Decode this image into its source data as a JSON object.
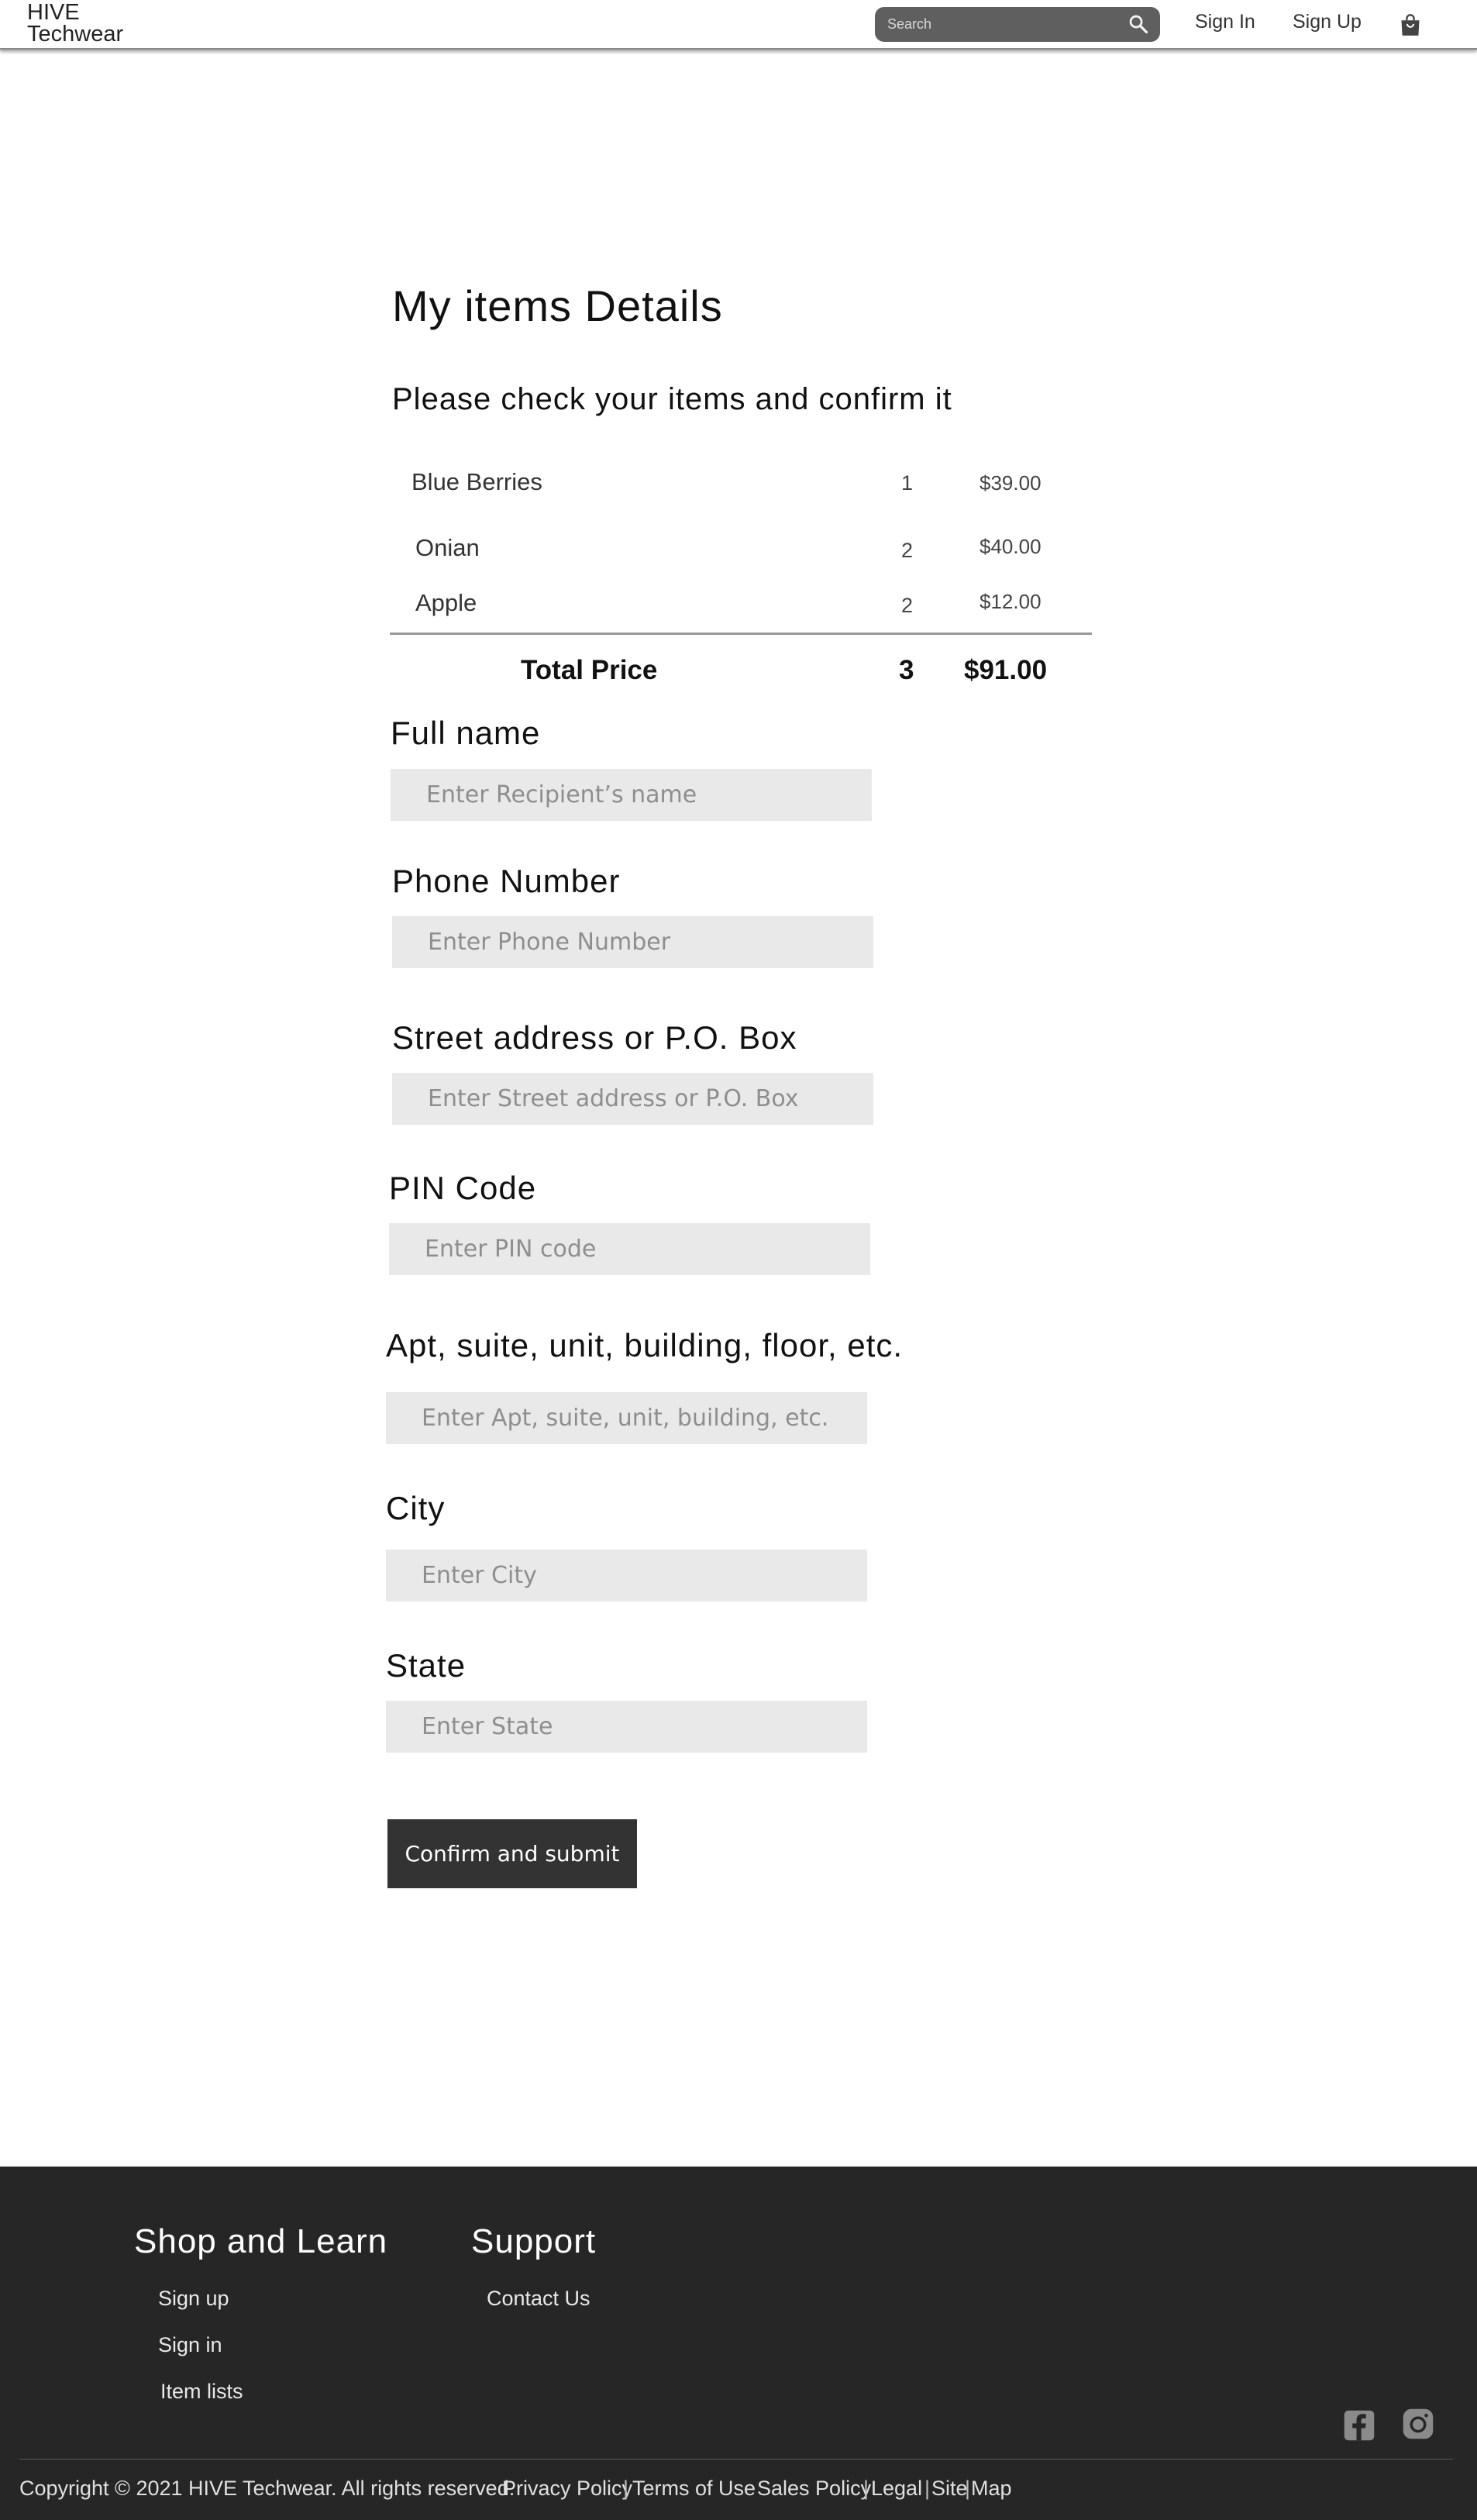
{
  "header": {
    "logo_line1": "HIVE",
    "logo_line2": "Techwear",
    "search_placeholder": "Search",
    "search_icon": "search-icon",
    "nav": {
      "sign_in": "Sign In",
      "sign_up": "Sign Up"
    },
    "cart_icon": "shopping-bag-icon"
  },
  "main": {
    "title": "My items Details",
    "subtitle": "Please check your items and confirm it",
    "items": [
      {
        "name": "Blue Berries",
        "qty": "1",
        "price": "$39.00"
      },
      {
        "name": "Onian",
        "qty": "2",
        "price": "$40.00"
      },
      {
        "name": "Apple",
        "qty": "2",
        "price": "$12.00"
      }
    ],
    "total": {
      "label": "Total Price",
      "qty": "3",
      "price": "$91.00"
    },
    "form": {
      "full_name": {
        "label": "Full name",
        "placeholder": "Enter Recipient’s name",
        "value": ""
      },
      "phone": {
        "label": "Phone Number",
        "placeholder": "Enter Phone Number",
        "value": ""
      },
      "street": {
        "label": "Street address or P.O. Box",
        "placeholder": "Enter Street address or P.O. Box",
        "value": ""
      },
      "pin": {
        "label": "PIN Code",
        "placeholder": "Enter PIN code",
        "value": ""
      },
      "apt": {
        "label": "Apt, suite, unit, building, floor, etc.",
        "placeholder": "Enter Apt, suite, unit, building, etc.",
        "value": ""
      },
      "city": {
        "label": "City",
        "placeholder": "Enter City",
        "value": ""
      },
      "state": {
        "label": "State",
        "placeholder": "Enter State",
        "value": ""
      }
    },
    "confirm_label": "Confirm and submit"
  },
  "footer": {
    "shop_heading": "Shop and Learn",
    "shop_links": [
      "Sign up",
      "Sign in",
      "Item lists"
    ],
    "support_heading": "Support",
    "support_links": [
      "Contact Us"
    ],
    "social_icons": [
      "facebook-icon",
      "instagram-icon"
    ],
    "copyright": "Copyright © 2021 HIVE Techwear. All rights reserved.",
    "legal_links": [
      "Privacy Policy",
      "Terms of Use",
      "Sales Policy",
      "Legal",
      "Site",
      "Map"
    ]
  },
  "colors": {
    "header_bg": "#ffffff",
    "search_bg": "#5f5f5f",
    "input_bg": "#e9e9e9",
    "button_bg": "#333333",
    "footer_bg": "#262626"
  }
}
